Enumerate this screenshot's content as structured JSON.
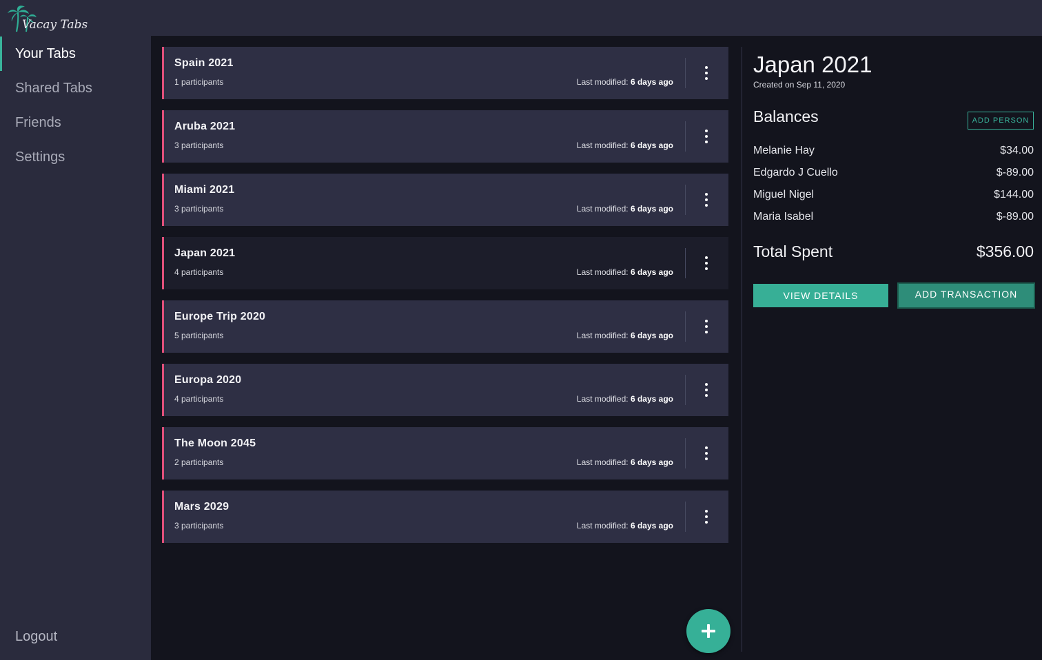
{
  "app": {
    "name": "Vacay Tabs"
  },
  "sidebar": {
    "items": [
      {
        "label": "Your Tabs",
        "active": true
      },
      {
        "label": "Shared Tabs",
        "active": false
      },
      {
        "label": "Friends",
        "active": false
      },
      {
        "label": "Settings",
        "active": false
      }
    ],
    "logout_label": "Logout"
  },
  "tabs": [
    {
      "name": "Spain 2021",
      "participants": "1 participants",
      "modified_label": "Last modified:",
      "modified_value": "6 days ago"
    },
    {
      "name": "Aruba 2021",
      "participants": "3 participants",
      "modified_label": "Last modified:",
      "modified_value": "6 days ago"
    },
    {
      "name": "Miami 2021",
      "participants": "3 participants",
      "modified_label": "Last modified:",
      "modified_value": "6 days ago"
    },
    {
      "name": "Japan 2021",
      "participants": "4 participants",
      "modified_label": "Last modified:",
      "modified_value": "6 days ago",
      "selected": true
    },
    {
      "name": "Europe Trip 2020",
      "participants": "5 participants",
      "modified_label": "Last modified:",
      "modified_value": "6 days ago"
    },
    {
      "name": "Europa 2020",
      "participants": "4 participants",
      "modified_label": "Last modified:",
      "modified_value": "6 days ago"
    },
    {
      "name": "The Moon 2045",
      "participants": "2 participants",
      "modified_label": "Last modified:",
      "modified_value": "6 days ago"
    },
    {
      "name": "Mars 2029",
      "participants": "3 participants",
      "modified_label": "Last modified:",
      "modified_value": "6 days ago"
    }
  ],
  "detail": {
    "title": "Japan 2021",
    "created": "Created on Sep 11, 2020",
    "balances_title": "Balances",
    "add_person_label": "ADD PERSON",
    "balances": [
      {
        "name": "Melanie Hay",
        "amount": "$34.00"
      },
      {
        "name": "Edgardo J Cuello",
        "amount": "$-89.00"
      },
      {
        "name": "Miguel Nigel",
        "amount": "$144.00"
      },
      {
        "name": "Maria Isabel",
        "amount": "$-89.00"
      }
    ],
    "total_label": "Total Spent",
    "total_value": "$356.00",
    "view_details_label": "VIEW DETAILS",
    "add_transaction_label": "ADD TRANSACTION"
  },
  "icons": {
    "logo": "palm-tree-icon",
    "card_menu": "more-vertical-icon",
    "fab": "plus-icon"
  },
  "colors": {
    "accent": "#39b39b",
    "card_border": "#e0507a",
    "card_bg": "#2e2f44",
    "sidebar_bg": "#2a2b3d",
    "page_bg": "#13141d"
  }
}
